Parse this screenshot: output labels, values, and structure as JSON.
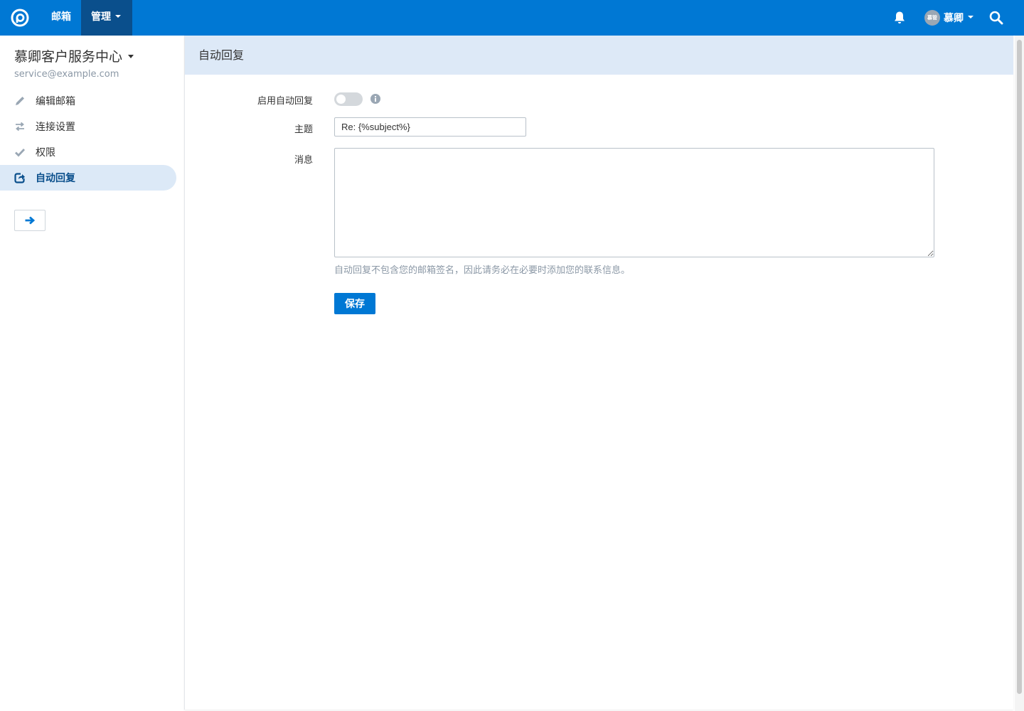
{
  "colors": {
    "brand": "#0078d4",
    "brand_dark": "#0a4f8c",
    "active_bg": "#dce9f7",
    "muted": "#8b98a6"
  },
  "navbar": {
    "logo_icon": "helpdesk-logo-icon",
    "mailbox_label": "邮箱",
    "manage_label": "管理",
    "bell_icon": "bell-icon",
    "user": {
      "avatar_text": "慕管",
      "name": "慕卿"
    },
    "search_icon": "search-icon"
  },
  "sidebar": {
    "mailbox_name": "慕卿客户服务中心",
    "mailbox_email": "service@example.com",
    "items": [
      {
        "label": "编辑邮箱",
        "icon": "pencil-icon"
      },
      {
        "label": "连接设置",
        "icon": "arrows-exchange-icon"
      },
      {
        "label": "权限",
        "icon": "check-icon"
      },
      {
        "label": "自动回复",
        "icon": "share-square-icon",
        "active": true
      }
    ],
    "collapse_icon": "arrow-right-icon"
  },
  "main": {
    "page_title": "自动回复",
    "form": {
      "enable_label": "启用自动回复",
      "enable_on": false,
      "subject_label": "主题",
      "subject_value": "Re: {%subject%}",
      "message_label": "消息",
      "message_value": "",
      "help_text": "自动回复不包含您的邮箱签名，因此请务必在必要时添加您的联系信息。",
      "save_label": "保存"
    }
  }
}
